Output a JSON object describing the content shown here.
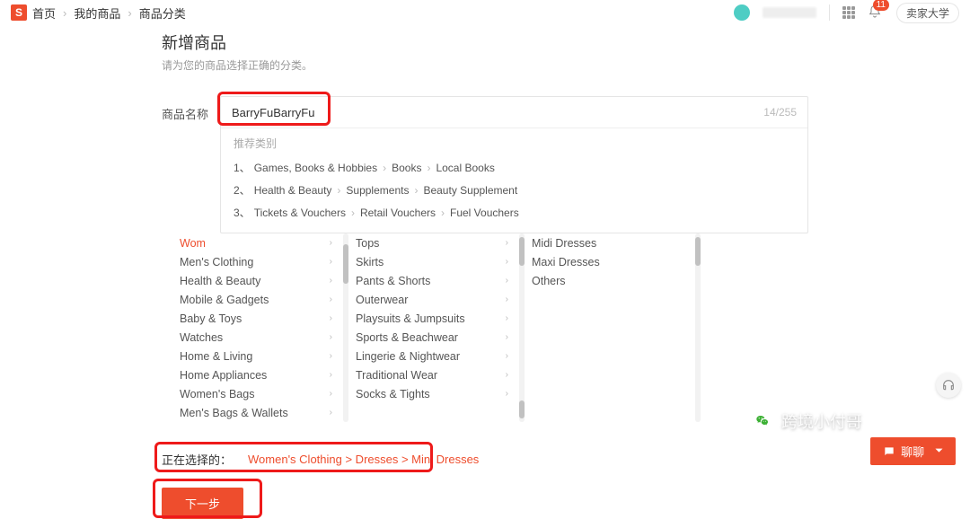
{
  "header": {
    "logo": "S",
    "breadcrumb": [
      "首页",
      "我的商品",
      "商品分类"
    ],
    "badge": "11",
    "seller_btn": "卖家大学"
  },
  "page": {
    "title": "新增商品",
    "subtitle": "请为您的商品选择正确的分类。"
  },
  "name_field": {
    "label": "商品名称",
    "value": "BarryFuBarryFu",
    "counter": "14/255"
  },
  "suggest": {
    "title": "推荐类别",
    "items": [
      {
        "prefix": "1、",
        "path": [
          "Games, Books & Hobbies",
          "Books",
          "Local Books"
        ]
      },
      {
        "prefix": "2、",
        "path": [
          "Health & Beauty",
          "Supplements",
          "Beauty Supplement"
        ]
      },
      {
        "prefix": "3、",
        "path": [
          "Tickets & Vouchers",
          "Retail Vouchers",
          "Fuel Vouchers"
        ]
      }
    ]
  },
  "cols": {
    "col1": [
      "Wom",
      "Men's Clothing",
      "Health & Beauty",
      "Mobile & Gadgets",
      "Baby & Toys",
      "Watches",
      "Home & Living",
      "Home Appliances",
      "Women's Bags",
      "Men's Bags & Wallets"
    ],
    "col2": [
      "Tops",
      "Skirts",
      "Pants & Shorts",
      "Outerwear",
      "Playsuits & Jumpsuits",
      "Sports & Beachwear",
      "Lingerie & Nightwear",
      "Traditional Wear",
      "Socks & Tights"
    ],
    "col3": [
      "Midi Dresses",
      "Maxi Dresses",
      "Others"
    ]
  },
  "selected": {
    "label": "正在选择的：",
    "path": "Women's Clothing > Dresses > Mini Dresses"
  },
  "next_btn": "下一步",
  "chat": "聊聊",
  "watermark": "跨境小付哥"
}
